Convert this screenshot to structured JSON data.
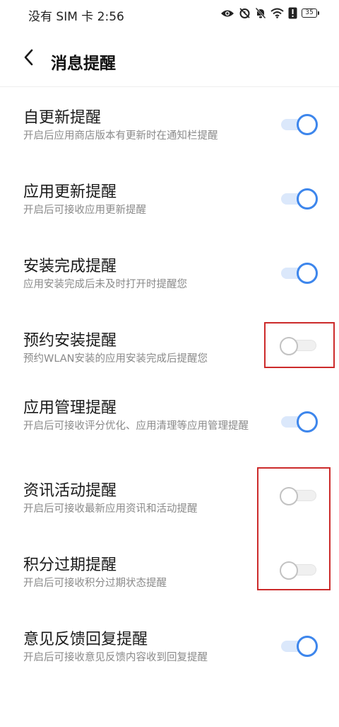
{
  "status_bar": {
    "carrier_time": "没有 SIM 卡 2:56",
    "battery_level": "35",
    "icons": [
      "eye-icon",
      "alarm-off-icon",
      "bell-off-icon",
      "wifi-icon",
      "alert-icon",
      "battery-icon"
    ]
  },
  "header": {
    "back_icon": "chevron-left-icon",
    "title": "消息提醒"
  },
  "settings": [
    {
      "title": "自更新提醒",
      "description": "开启后应用商店版本有更新时在通知栏提醒",
      "enabled": true
    },
    {
      "title": "应用更新提醒",
      "description": "开启后可接收应用更新提醒",
      "enabled": true
    },
    {
      "title": "安装完成提醒",
      "description": "应用安装完成后未及时打开时提醒您",
      "enabled": true
    },
    {
      "title": "预约安装提醒",
      "description": "预约WLAN安装的应用安装完成后提醒您",
      "enabled": false
    },
    {
      "title": "应用管理提醒",
      "description": "开启后可接收评分优化、应用清理等应用管理提醒",
      "enabled": true
    },
    {
      "title": "资讯活动提醒",
      "description": "开启后可接收最新应用资讯和活动提醒",
      "enabled": false
    },
    {
      "title": "积分过期提醒",
      "description": "开启后可接收积分过期状态提醒",
      "enabled": false
    },
    {
      "title": "意见反馈回复提醒",
      "description": "开启后可接收意见反馈内容收到回复提醒",
      "enabled": true
    }
  ],
  "colors": {
    "toggle_on": "#3d86ec",
    "toggle_on_track": "#dbe8fb",
    "toggle_off": "#c2c2c2",
    "highlight": "#cc2b2b"
  }
}
